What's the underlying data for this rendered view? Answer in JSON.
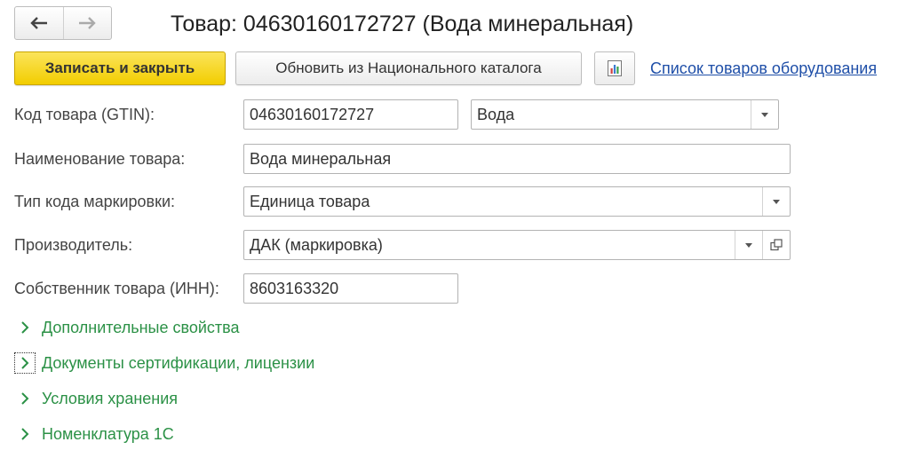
{
  "window": {
    "title": "Товар: 04630160172727 (Вода минеральная)"
  },
  "toolbar": {
    "save_close_label": "Записать и закрыть",
    "update_label": "Обновить из Национального каталога",
    "report_icon": "report-chart-icon",
    "equipment_link": "Список товаров оборудования"
  },
  "form": {
    "gtin": {
      "label": "Код товара (GTIN):",
      "value": "04630160172727",
      "category": "Вода"
    },
    "name": {
      "label": "Наименование товара:",
      "value": "Вода минеральная"
    },
    "marking_type": {
      "label": "Тип кода маркировки:",
      "value": "Единица товара"
    },
    "manufacturer": {
      "label": "Производитель:",
      "value": "ДАК (маркировка)"
    },
    "owner": {
      "label": "Собственник товара (ИНН):",
      "value": "8603163320"
    }
  },
  "groups": [
    {
      "label": "Дополнительные свойства"
    },
    {
      "label": "Документы сертификации, лицензии"
    },
    {
      "label": "Условия хранения"
    },
    {
      "label": "Номенклатура 1С"
    }
  ],
  "colors": {
    "primary_button": "#f2cd00",
    "link": "#1f4fa8",
    "group_text": "#2b9146"
  }
}
